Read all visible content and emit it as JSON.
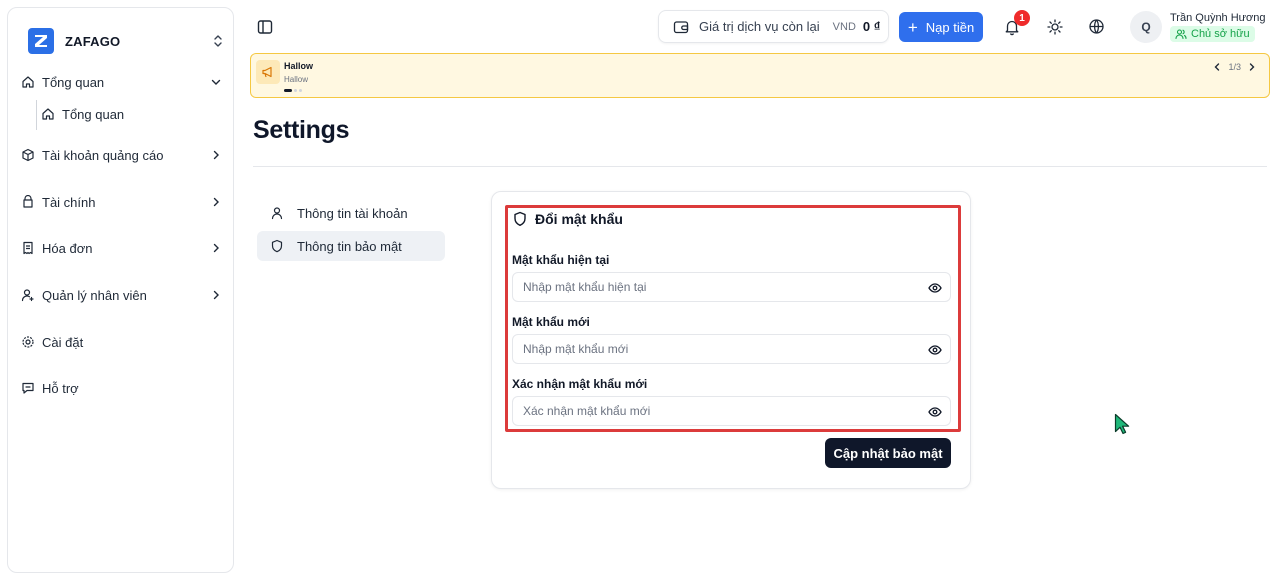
{
  "brand": {
    "name": "ZAFAGO",
    "logo_letter": "Z",
    "logo_color": "#2b6fe6"
  },
  "sidebar": {
    "items": [
      {
        "label": "Tổng quan",
        "icon": "home-icon",
        "expanded": true
      },
      {
        "label": "Tài khoản quảng cáo",
        "icon": "cube-icon"
      },
      {
        "label": "Tài chính",
        "icon": "wallet-icon"
      },
      {
        "label": "Hóa đơn",
        "icon": "receipt-icon"
      },
      {
        "label": "Quản lý nhân viên",
        "icon": "user-cog-icon"
      },
      {
        "label": "Cài đặt",
        "icon": "gear-icon"
      },
      {
        "label": "Hỗ trợ",
        "icon": "chat-icon"
      }
    ],
    "sub_items": [
      {
        "label": "Tổng quan",
        "icon": "home-icon"
      }
    ]
  },
  "header": {
    "balance_label": "Giá trị dịch vụ còn lại",
    "currency": "VND",
    "balance_amount": "0 ₫",
    "topup_label": "Nạp tiền",
    "notification_count": "1",
    "user_initial": "Q",
    "user_name": "Trần Quỳnh Hương",
    "user_role": "Chủ sở hữu",
    "accent_color": "#2f6fed"
  },
  "announcement": {
    "title": "Hallow",
    "subtitle": "Hallow",
    "pager": "1/3",
    "active_index": 1,
    "total": 3
  },
  "page": {
    "title": "Settings"
  },
  "settings_tabs": [
    {
      "label": "Thông tin tài khoản",
      "icon": "user-icon",
      "active": false
    },
    {
      "label": "Thông tin bảo mật",
      "icon": "shield-icon",
      "active": true
    }
  ],
  "password_form": {
    "title": "Đổi mật khẩu",
    "current": {
      "label": "Mật khẩu hiện tại",
      "placeholder": "Nhập mật khẩu hiện tại"
    },
    "new": {
      "label": "Mật khẩu mới",
      "placeholder": "Nhập mật khẩu mới"
    },
    "confirm": {
      "label": "Xác nhận mật khẩu mới",
      "placeholder": "Xác nhận mật khẩu mới"
    },
    "submit_label": "Cập nhật bảo mật",
    "highlight_color": "#dc3b3b"
  }
}
